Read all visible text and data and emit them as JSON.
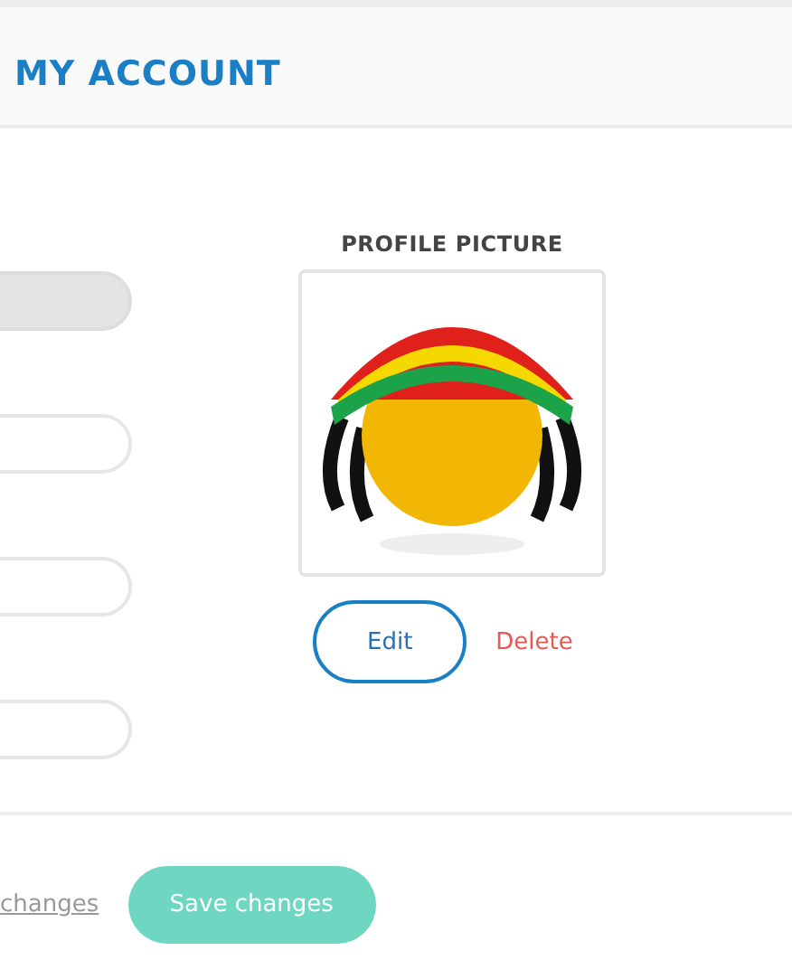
{
  "header": {
    "title": "MY ACCOUNT"
  },
  "fields": [
    {
      "disabled": true
    },
    {
      "disabled": false
    },
    {
      "disabled": false
    },
    {
      "disabled": false
    }
  ],
  "profile_picture": {
    "label": "PROFILE PICTURE",
    "edit_button": "Edit",
    "delete_link": "Delete"
  },
  "footer": {
    "discard_link": "changes",
    "save_button": "Save changes"
  }
}
